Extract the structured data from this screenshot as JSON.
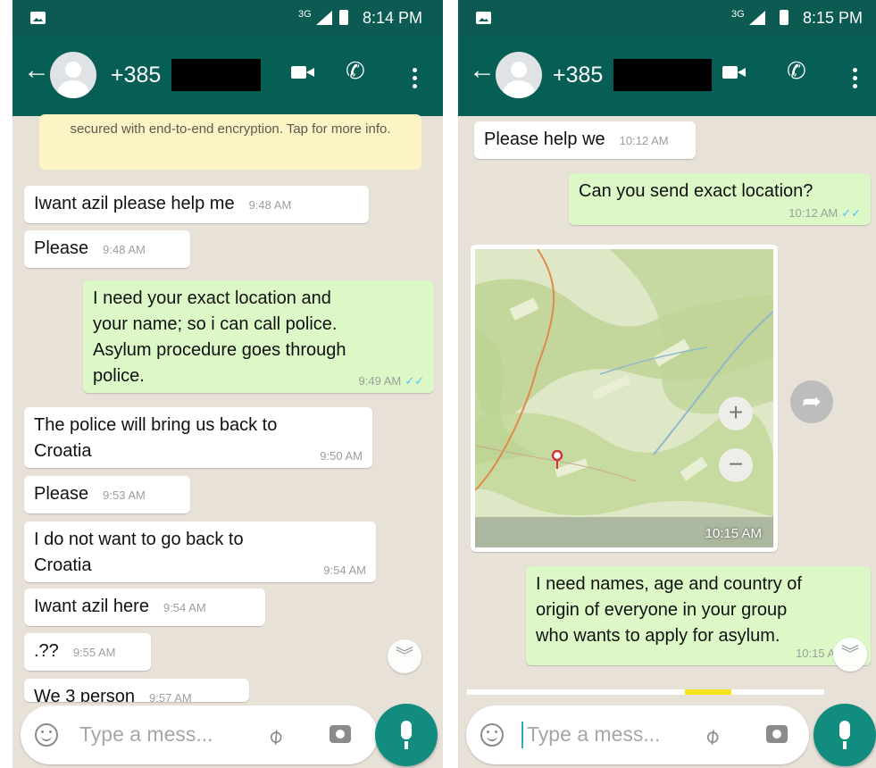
{
  "left": {
    "status": {
      "network": "3G",
      "time": "8:14 PM"
    },
    "header": {
      "contact": "+385",
      "back_icon": "arrow-left-icon",
      "video_icon": "videocam-icon",
      "call_icon": "phone-icon",
      "menu_icon": "more-vert-icon"
    },
    "encryption_notice": "secured with end-to-end encryption. Tap for more info.",
    "messages": [
      {
        "dir": "in",
        "text": "Iwant azil please help me",
        "time": "9:48 AM"
      },
      {
        "dir": "in",
        "text": "Please",
        "time": "9:48 AM"
      },
      {
        "dir": "out",
        "text": "I need your exact location and\nyour name; so i can call police.\nAsylum procedure goes through\npolice.",
        "time": "9:49 AM",
        "status": "read"
      },
      {
        "dir": "in",
        "text": "The police will bring us back to\nCroatia",
        "time": "9:50 AM"
      },
      {
        "dir": "in",
        "text": "Please",
        "time": "9:53 AM"
      },
      {
        "dir": "in",
        "text": "I do not want to go back to\nCroatia",
        "time": "9:54 AM"
      },
      {
        "dir": "in",
        "text": "Iwant azil here",
        "time": "9:54 AM"
      },
      {
        "dir": "in",
        "text": ".??",
        "time": "9:55 AM"
      },
      {
        "dir": "in",
        "text": "We 3 person",
        "time": "9:57 AM"
      }
    ],
    "input": {
      "placeholder": "Type a mess...",
      "emoji_icon": "emoji-icon",
      "attach_icon": "paperclip-icon",
      "camera_icon": "camera-icon",
      "mic_icon": "mic-icon"
    }
  },
  "right": {
    "status": {
      "network": "3G",
      "time": "8:15 PM"
    },
    "header": {
      "contact": "+385",
      "back_icon": "arrow-left-icon",
      "video_icon": "videocam-icon",
      "call_icon": "phone-icon",
      "menu_icon": "more-vert-icon"
    },
    "messages": [
      {
        "dir": "in",
        "text": "Please help we",
        "time": "10:12 AM"
      },
      {
        "dir": "out",
        "text": "Can you send exact location?",
        "time": "10:12 AM",
        "status": "read"
      },
      {
        "dir": "in",
        "type": "location",
        "time": "10:15 AM"
      },
      {
        "dir": "out",
        "text": "I need names, age and country of\norigin of everyone in your group\nwho wants to apply for asylum.",
        "time": "10:15 AM"
      }
    ],
    "input": {
      "placeholder": "Type a mess...",
      "emoji_icon": "emoji-icon",
      "attach_icon": "paperclip-icon",
      "camera_icon": "camera-icon",
      "mic_icon": "mic-icon"
    }
  },
  "colors": {
    "header": "#075e54",
    "statusbar": "#0b5b53",
    "incoming": "#ffffff",
    "outgoing": "#dcf8c6",
    "chat_bg": "#e7e1d8",
    "read_tick": "#4fc3f7",
    "fab": "#128c7e"
  }
}
